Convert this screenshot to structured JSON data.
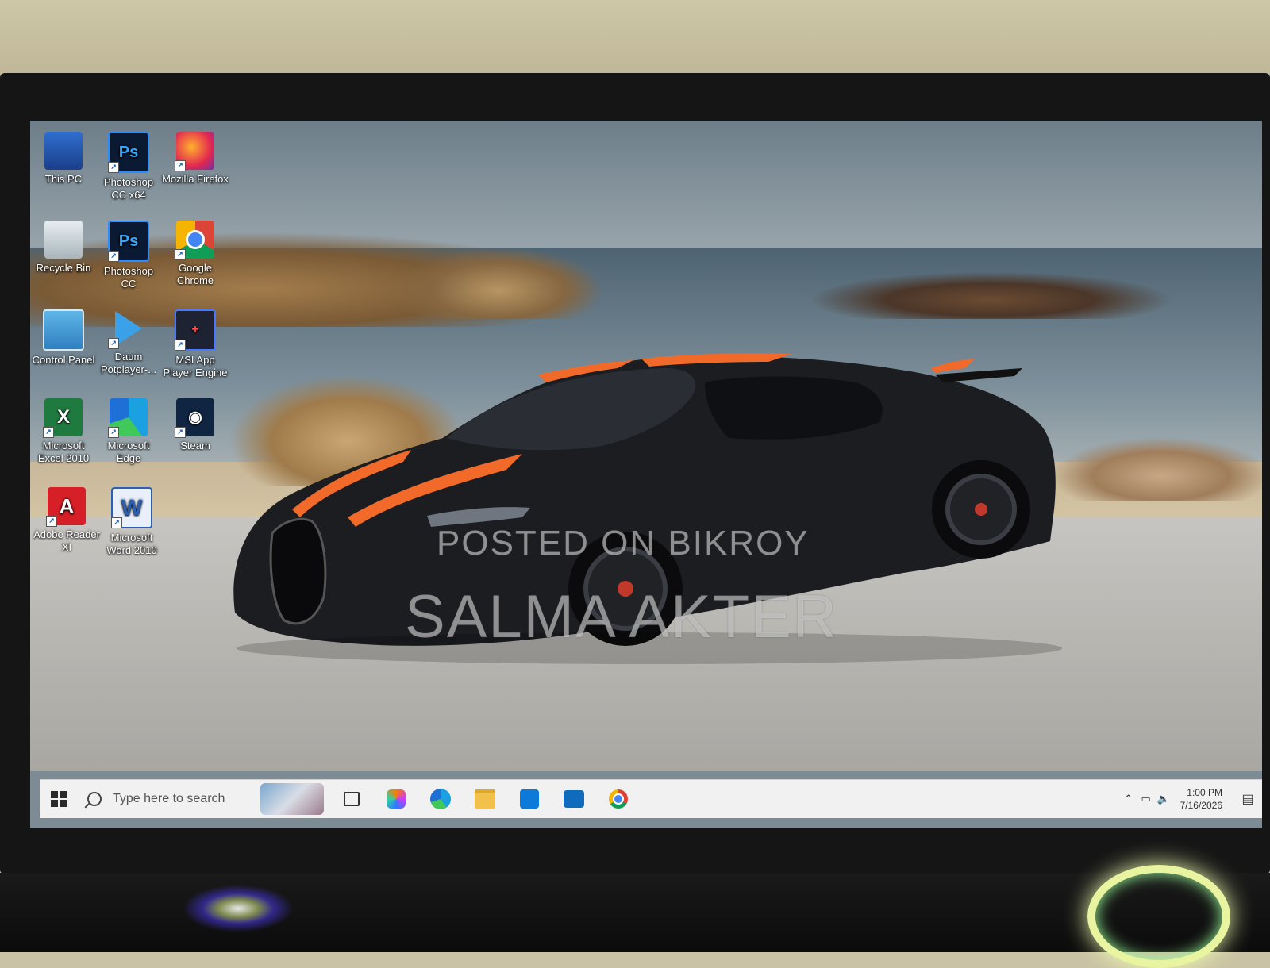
{
  "desktop": {
    "icons": [
      {
        "label": "This PC",
        "icon": "computer-icon"
      },
      {
        "label": "Photoshop CC x64",
        "icon": "photoshop-icon",
        "glyph": "Ps"
      },
      {
        "label": "Mozilla Firefox",
        "icon": "firefox-icon"
      },
      {
        "label": "Recycle Bin",
        "icon": "recycle-bin-icon"
      },
      {
        "label": "Photoshop CC",
        "icon": "photoshop-icon",
        "glyph": "Ps"
      },
      {
        "label": "Google Chrome",
        "icon": "chrome-icon"
      },
      {
        "label": "Control Panel",
        "icon": "control-panel-icon"
      },
      {
        "label": "Daum Potplayer-...",
        "icon": "potplayer-icon"
      },
      {
        "label": "MSI App Player Engine",
        "icon": "msi-app-player-icon",
        "glyph": "+"
      },
      {
        "label": "Microsoft Excel 2010",
        "icon": "excel-icon",
        "glyph": "X"
      },
      {
        "label": "Microsoft Edge",
        "icon": "edge-icon"
      },
      {
        "label": "Steam",
        "icon": "steam-icon",
        "glyph": "◉"
      },
      {
        "label": "Adobe Reader XI",
        "icon": "adobe-reader-icon",
        "glyph": "A"
      },
      {
        "label": "Microsoft Word 2010",
        "icon": "word-icon",
        "glyph": "W"
      }
    ]
  },
  "wallpaper": {
    "watermark_line1": "POSTED ON BIKROY",
    "watermark_line2": "SALMA AKTER"
  },
  "taskbar": {
    "search_placeholder": "Type here to search",
    "pinned": [
      "task-view-icon",
      "copilot-icon",
      "edge-icon",
      "file-explorer-icon",
      "microsoft-store-icon",
      "outlook-icon",
      "chrome-icon"
    ],
    "tray": {
      "time": "1:00 PM",
      "date": "7/16/2026"
    }
  },
  "colors": {
    "taskbar_bg": "#f1f1f1",
    "car_stripe": "#f26a2a",
    "car_body": "#1c1d21"
  }
}
